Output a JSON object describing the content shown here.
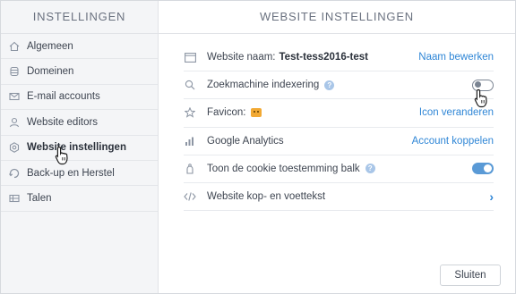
{
  "sidebar": {
    "title": "INSTELLINGEN",
    "items": [
      {
        "label": "Algemeen",
        "icon": "home-icon"
      },
      {
        "label": "Domeinen",
        "icon": "database-icon"
      },
      {
        "label": "E-mail accounts",
        "icon": "envelope-icon"
      },
      {
        "label": "Website editors",
        "icon": "user-icon"
      },
      {
        "label": "Website instellingen",
        "icon": "gear-icon"
      },
      {
        "label": "Back-up en Herstel",
        "icon": "backup-icon"
      },
      {
        "label": "Talen",
        "icon": "flag-icon"
      }
    ]
  },
  "main": {
    "title": "WEBSITE INSTELLINGEN",
    "rows": [
      {
        "label": "Website naam:",
        "value": "Test-tess2016-test",
        "action": "Naam bewerken"
      },
      {
        "label": "Zoekmachine indexering",
        "toggle": "off"
      },
      {
        "label": "Favicon:",
        "action": "Icon veranderen"
      },
      {
        "label": "Google Analytics",
        "action": "Account koppelen"
      },
      {
        "label": "Toon de cookie toestemming balk",
        "toggle": "on"
      },
      {
        "label": "Website kop- en voettekst"
      }
    ],
    "close_label": "Sluiten"
  },
  "colors": {
    "accent": "#2f86d6",
    "toggle_on": "#5a9ad6"
  }
}
